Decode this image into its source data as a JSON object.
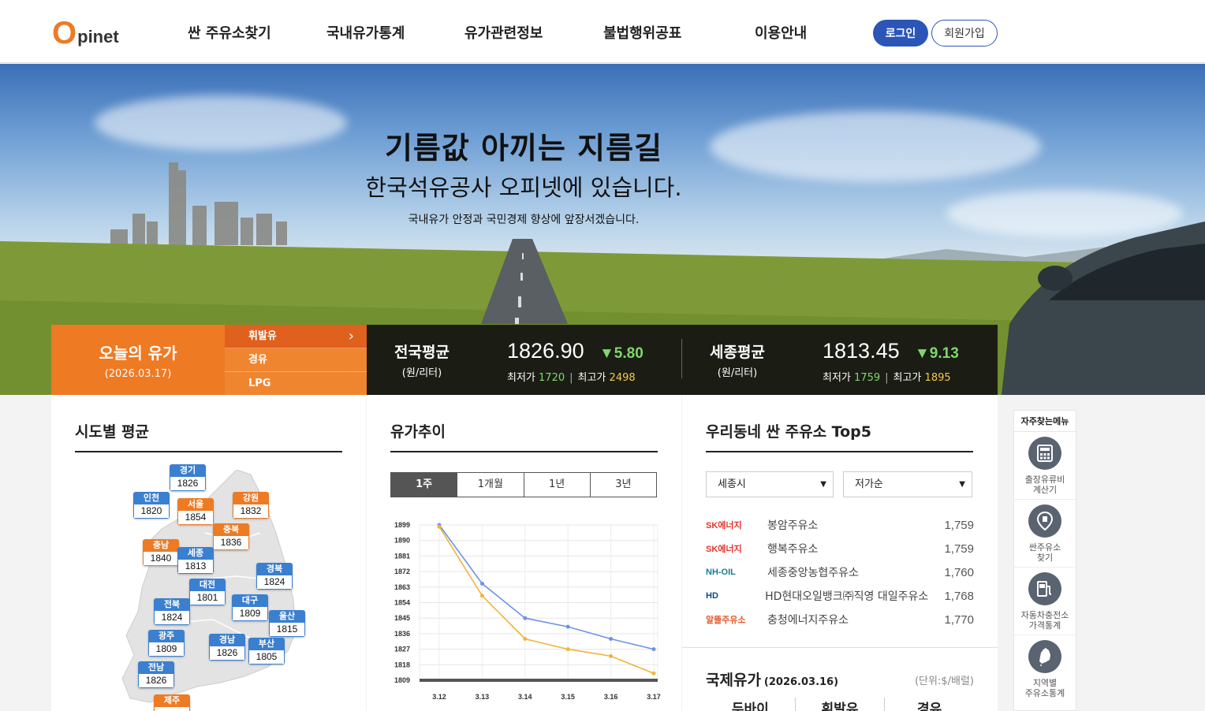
{
  "header": {
    "logo_o": "O",
    "logo_rest": "pinet",
    "nav": [
      "싼 주유소찾기",
      "국내유가통계",
      "유가관련정보",
      "불법행위공표",
      "이용안내"
    ],
    "login": "로그인",
    "join": "회원가입"
  },
  "hero": {
    "title": "기름값 아끼는 지름길",
    "subtitle": "한국석유공사 오피넷에 있습니다.",
    "desc": "국내유가 안정과 국민경제 향상에 앞장서겠습니다."
  },
  "today": {
    "title": "오늘의 유가",
    "date": "(2026.03.17)",
    "fuels": [
      "휘발유",
      "경유",
      "LPG"
    ],
    "chevron": "›"
  },
  "averages": [
    {
      "label": "전국평균",
      "unit": "(원/리터)",
      "value": "1826.90",
      "change": "▼5.80",
      "min_label": "최저가",
      "min": "1720",
      "max_label": "최고가",
      "max": "2498",
      "bar": "|"
    },
    {
      "label": "세종평균",
      "unit": "(원/리터)",
      "value": "1813.45",
      "change": "▼9.13",
      "min_label": "최저가",
      "min": "1759",
      "max_label": "최고가",
      "max": "1895",
      "bar": "|"
    }
  ],
  "regional": {
    "title": "시도별 평균",
    "regions": [
      {
        "name": "경기",
        "value": "1826",
        "color": "blue"
      },
      {
        "name": "인천",
        "value": "1820",
        "color": "blue"
      },
      {
        "name": "서울",
        "value": "1854",
        "color": "orange"
      },
      {
        "name": "강원",
        "value": "1832",
        "color": "orange"
      },
      {
        "name": "충북",
        "value": "1836",
        "color": "orange"
      },
      {
        "name": "충남",
        "value": "1840",
        "color": "orange"
      },
      {
        "name": "세종",
        "value": "1813",
        "color": "blue"
      },
      {
        "name": "경북",
        "value": "1824",
        "color": "blue"
      },
      {
        "name": "대전",
        "value": "1801",
        "color": "blue"
      },
      {
        "name": "전북",
        "value": "1824",
        "color": "blue"
      },
      {
        "name": "대구",
        "value": "1809",
        "color": "blue"
      },
      {
        "name": "울산",
        "value": "1815",
        "color": "blue"
      },
      {
        "name": "광주",
        "value": "1809",
        "color": "blue"
      },
      {
        "name": "경남",
        "value": "1826",
        "color": "blue"
      },
      {
        "name": "부산",
        "value": "1805",
        "color": "blue"
      },
      {
        "name": "전남",
        "value": "1826",
        "color": "blue"
      },
      {
        "name": "제주",
        "value": "",
        "color": "orange"
      }
    ]
  },
  "trend": {
    "title": "유가추이",
    "periods": [
      "1주",
      "1개월",
      "1년",
      "3년"
    ],
    "active_period": 0
  },
  "chart_data": {
    "type": "line",
    "x": [
      "3.12",
      "3.13",
      "3.14",
      "3.15",
      "3.16",
      "3.17"
    ],
    "y_ticks": [
      1899,
      1890,
      1881,
      1872,
      1863,
      1854,
      1845,
      1836,
      1827,
      1818,
      1809
    ],
    "ylim": [
      1809,
      1899
    ],
    "series": [
      {
        "values": [
          1899,
          1865,
          1845,
          1840,
          1833,
          1827
        ],
        "color": "#6c93e6"
      },
      {
        "values": [
          1898,
          1858,
          1833,
          1827,
          1823,
          1813
        ],
        "color": "#f0b43c"
      }
    ],
    "grid": true
  },
  "top5": {
    "title": "우리동네 싼 주유소 Top5",
    "region_select": "세종시",
    "sort_select": "저가순",
    "stations": [
      {
        "brand": "SK에너지",
        "brand_color": "#e4322b",
        "name": "봉암주유소",
        "price": "1,759"
      },
      {
        "brand": "SK에너지",
        "brand_color": "#e4322b",
        "name": "행복주유소",
        "price": "1,759"
      },
      {
        "brand": "NH-OIL",
        "brand_color": "#1a7d8f",
        "name": "세종중앙농협주유소",
        "price": "1,760"
      },
      {
        "brand": "HD",
        "brand_color": "#0a4c8b",
        "name": "HD현대오일뱅크㈜직영 대일주유소",
        "price": "1,768"
      },
      {
        "brand": "알뜰주유소",
        "brand_color": "#e4582b",
        "name": "충청에너지주유소",
        "price": "1,770"
      }
    ]
  },
  "intl": {
    "title": "국제유가",
    "date": "(2026.03.16)",
    "unit": "(단위:$/배럴)",
    "columns": [
      "두바이",
      "휘발유",
      "경유"
    ]
  },
  "quick": {
    "title": "자주찾는메뉴",
    "items": [
      {
        "label": "출장유류비\n계산기",
        "icon": "calculator-icon"
      },
      {
        "label": "싼주유소\n찾기",
        "icon": "location-pin-icon"
      },
      {
        "label": "자동차충전소\n가격통계",
        "icon": "charger-icon"
      },
      {
        "label": "지역별\n주유소통계",
        "icon": "korea-map-icon"
      }
    ]
  }
}
